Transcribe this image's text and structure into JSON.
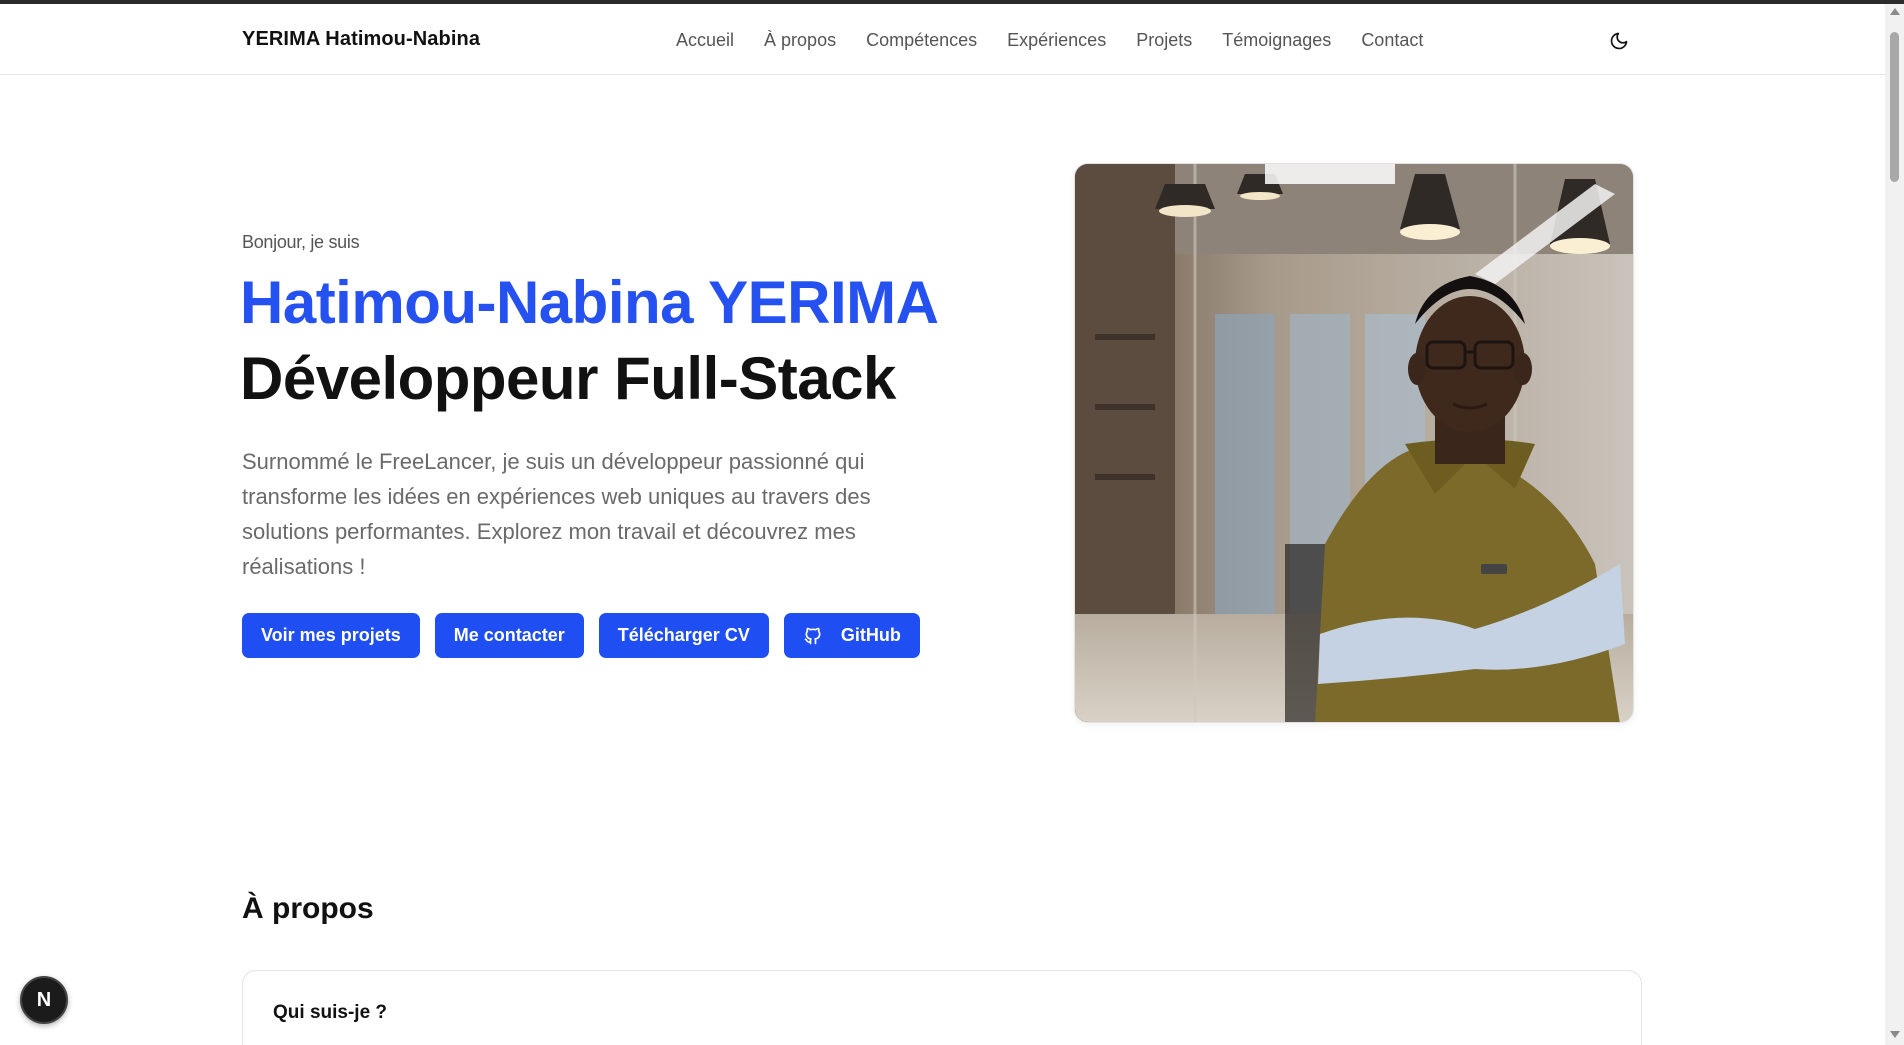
{
  "navbar": {
    "brand": "YERIMA Hatimou-Nabina",
    "links": [
      "Accueil",
      "À propos",
      "Compétences",
      "Expériences",
      "Projets",
      "Témoignages",
      "Contact"
    ],
    "theme_icon": "moon-icon"
  },
  "hero": {
    "intro": "Bonjour, je suis",
    "name": "Hatimou-Nabina YERIMA",
    "role": "Développeur Full-Stack",
    "description": "Surnommé le FreeLancer, je suis un développeur passionné qui transforme les idées en expériences web uniques au travers des solutions performantes. Explorez mon travail et découvrez mes réalisations !",
    "buttons": {
      "projects": "Voir mes projets",
      "contact": "Me contacter",
      "cv": "Télécharger CV",
      "github": "GitHub"
    }
  },
  "about": {
    "title": "À propos",
    "card_title": "Qui suis-je ?"
  },
  "dev_badge": "N",
  "colors": {
    "accent": "#2451f0",
    "button": "#1f4ff2",
    "text": "#111111",
    "muted": "#6a6a6a"
  }
}
